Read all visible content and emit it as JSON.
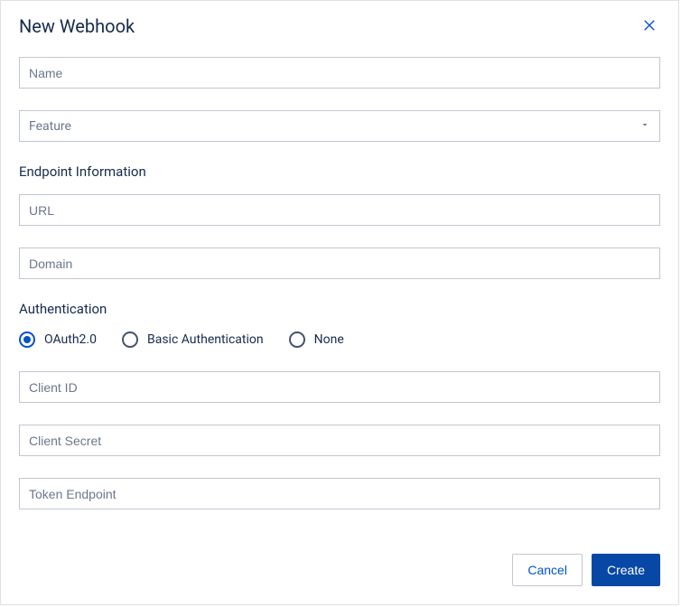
{
  "dialog": {
    "title": "New Webhook"
  },
  "fields": {
    "name_placeholder": "Name",
    "feature_placeholder": "Feature",
    "url_placeholder": "URL",
    "domain_placeholder": "Domain",
    "client_id_placeholder": "Client ID",
    "client_secret_placeholder": "Client Secret",
    "token_endpoint_placeholder": "Token Endpoint"
  },
  "sections": {
    "endpoint_info": "Endpoint Information",
    "authentication": "Authentication"
  },
  "auth_options": {
    "oauth2": "OAuth2.0",
    "basic": "Basic Authentication",
    "none": "None"
  },
  "buttons": {
    "cancel": "Cancel",
    "create": "Create"
  }
}
